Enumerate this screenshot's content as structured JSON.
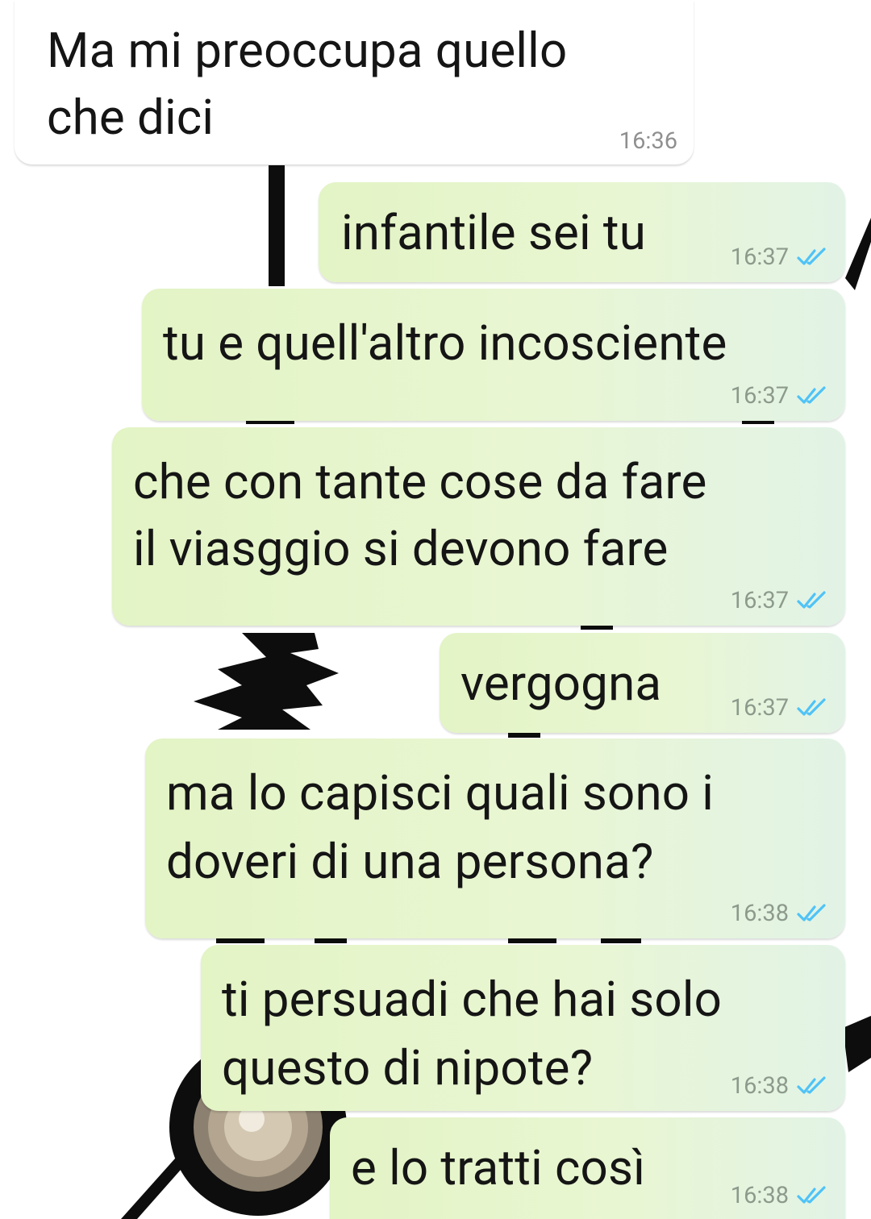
{
  "chat": {
    "messages": [
      {
        "direction": "incoming",
        "lines": [
          "Ma mi preoccupa quello",
          "che dici"
        ],
        "time": "16:36"
      },
      {
        "direction": "outgoing",
        "lines": [
          "infantile sei tu"
        ],
        "time": "16:37",
        "status": "read"
      },
      {
        "direction": "outgoing",
        "lines": [
          "tu e quell'altro incosciente"
        ],
        "time": "16:37",
        "status": "read"
      },
      {
        "direction": "outgoing",
        "lines": [
          "che con tante cose da fare",
          "il viasggio si devono fare"
        ],
        "time": "16:37",
        "status": "read"
      },
      {
        "direction": "outgoing",
        "lines": [
          "vergogna"
        ],
        "time": "16:37",
        "status": "read"
      },
      {
        "direction": "outgoing",
        "lines": [
          "ma lo capisci quali sono i",
          "doveri di una persona?"
        ],
        "time": "16:38",
        "status": "read"
      },
      {
        "direction": "outgoing",
        "lines": [
          "ti persuadi che hai solo",
          "questo di nipote?"
        ],
        "time": "16:38",
        "status": "read"
      },
      {
        "direction": "outgoing",
        "lines": [
          "e lo tratti così"
        ],
        "time": "16:38",
        "status": "read"
      }
    ]
  },
  "colors": {
    "outgoing_bubble": "#e6f5cc",
    "incoming_bubble": "#ffffff",
    "read_check": "#4fc3f7",
    "wallpaper_marks": "#0d0d0d"
  },
  "wallpaper": {
    "motif": "clock-hands-icon"
  }
}
